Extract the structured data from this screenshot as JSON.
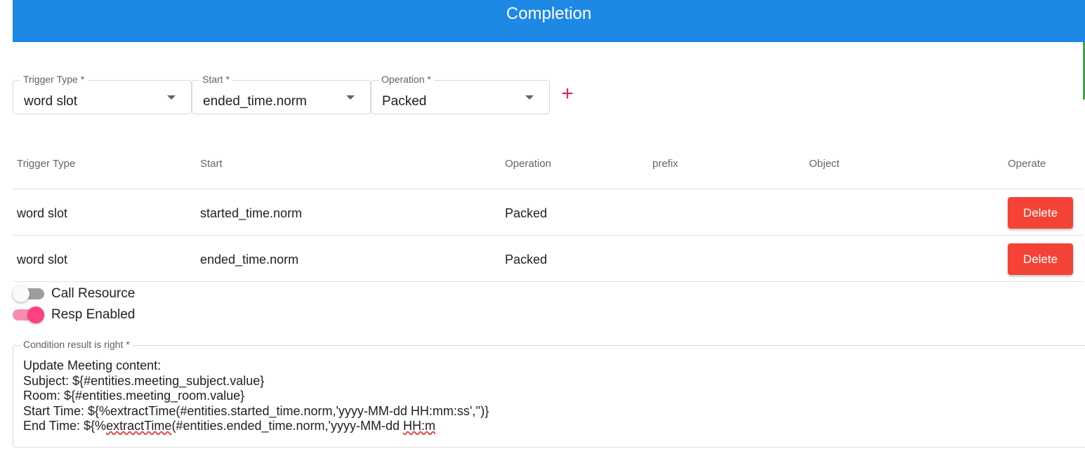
{
  "header": {
    "title": "Completion"
  },
  "form": {
    "trigger_type": {
      "label": "Trigger Type *",
      "value": "word slot"
    },
    "start": {
      "label": "Start *",
      "value": "ended_time.norm"
    },
    "operation": {
      "label": "Operation *",
      "value": "Packed"
    },
    "add_icon": "plus-icon",
    "add_glyph": "+"
  },
  "table": {
    "columns": [
      "Trigger Type",
      "Start",
      "Operation",
      "prefix",
      "Object",
      "Operate"
    ],
    "rows": [
      {
        "trigger_type": "word slot",
        "start": "started_time.norm",
        "operation": "Packed",
        "prefix": "",
        "object": "",
        "action": "Delete"
      },
      {
        "trigger_type": "word slot",
        "start": "ended_time.norm",
        "operation": "Packed",
        "prefix": "",
        "object": "",
        "action": "Delete"
      }
    ]
  },
  "toggles": [
    {
      "label": "Call Resource",
      "on": false
    },
    {
      "label": "Resp Enabled",
      "on": true
    }
  ],
  "condition": {
    "label": "Condition result is right *",
    "lines": [
      "Update Meeting content:",
      "Subject: ${#entities.meeting_subject.value}",
      "Room: ${#entities.meeting_room.value}",
      "Start Time: ${%extractTime(#entities.started_time.norm,'yyyy-MM-dd HH:mm:ss','')}"
    ],
    "last_line": {
      "prefix": "End Time: ${%",
      "misspelled_1": "extractTime",
      "middle": "(#entities.ended_time.norm,'yyyy-MM-dd ",
      "misspelled_2": "HH:m"
    }
  },
  "colors": {
    "header": "#1e88e5",
    "delete": "#f44336",
    "accent": "#ff4081"
  }
}
